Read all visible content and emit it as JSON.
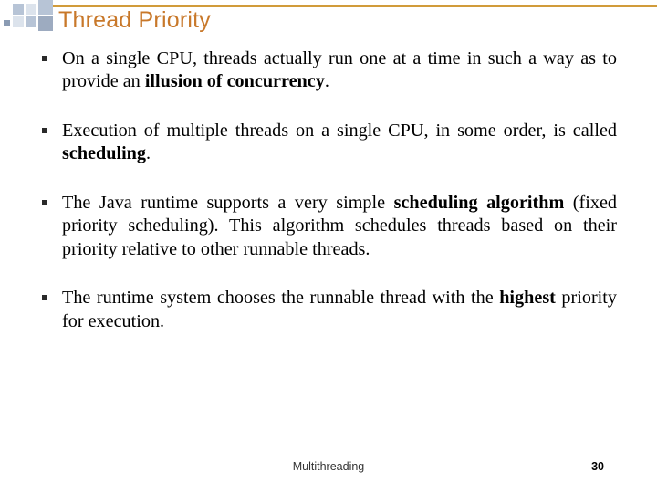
{
  "header": {
    "title": "Thread Priority"
  },
  "bullets": [
    {
      "pre": "On a single CPU, threads actually run one at a time in such a way as to provide an ",
      "bold": "illusion of concurrency",
      "post": "."
    },
    {
      "pre": "Execution of multiple threads on a single CPU, in some order, is called ",
      "bold": "scheduling",
      "post": "."
    },
    {
      "pre": "The Java runtime supports a very simple ",
      "bold": "scheduling algorithm",
      "post": " (fixed priority scheduling). This algorithm schedules threads based on their priority relative to other runnable threads."
    },
    {
      "pre": "The runtime system chooses the runnable thread with the ",
      "bold": "highest",
      "post": " priority for execution."
    }
  ],
  "footer": {
    "topic": "Multithreading",
    "page": "30"
  }
}
